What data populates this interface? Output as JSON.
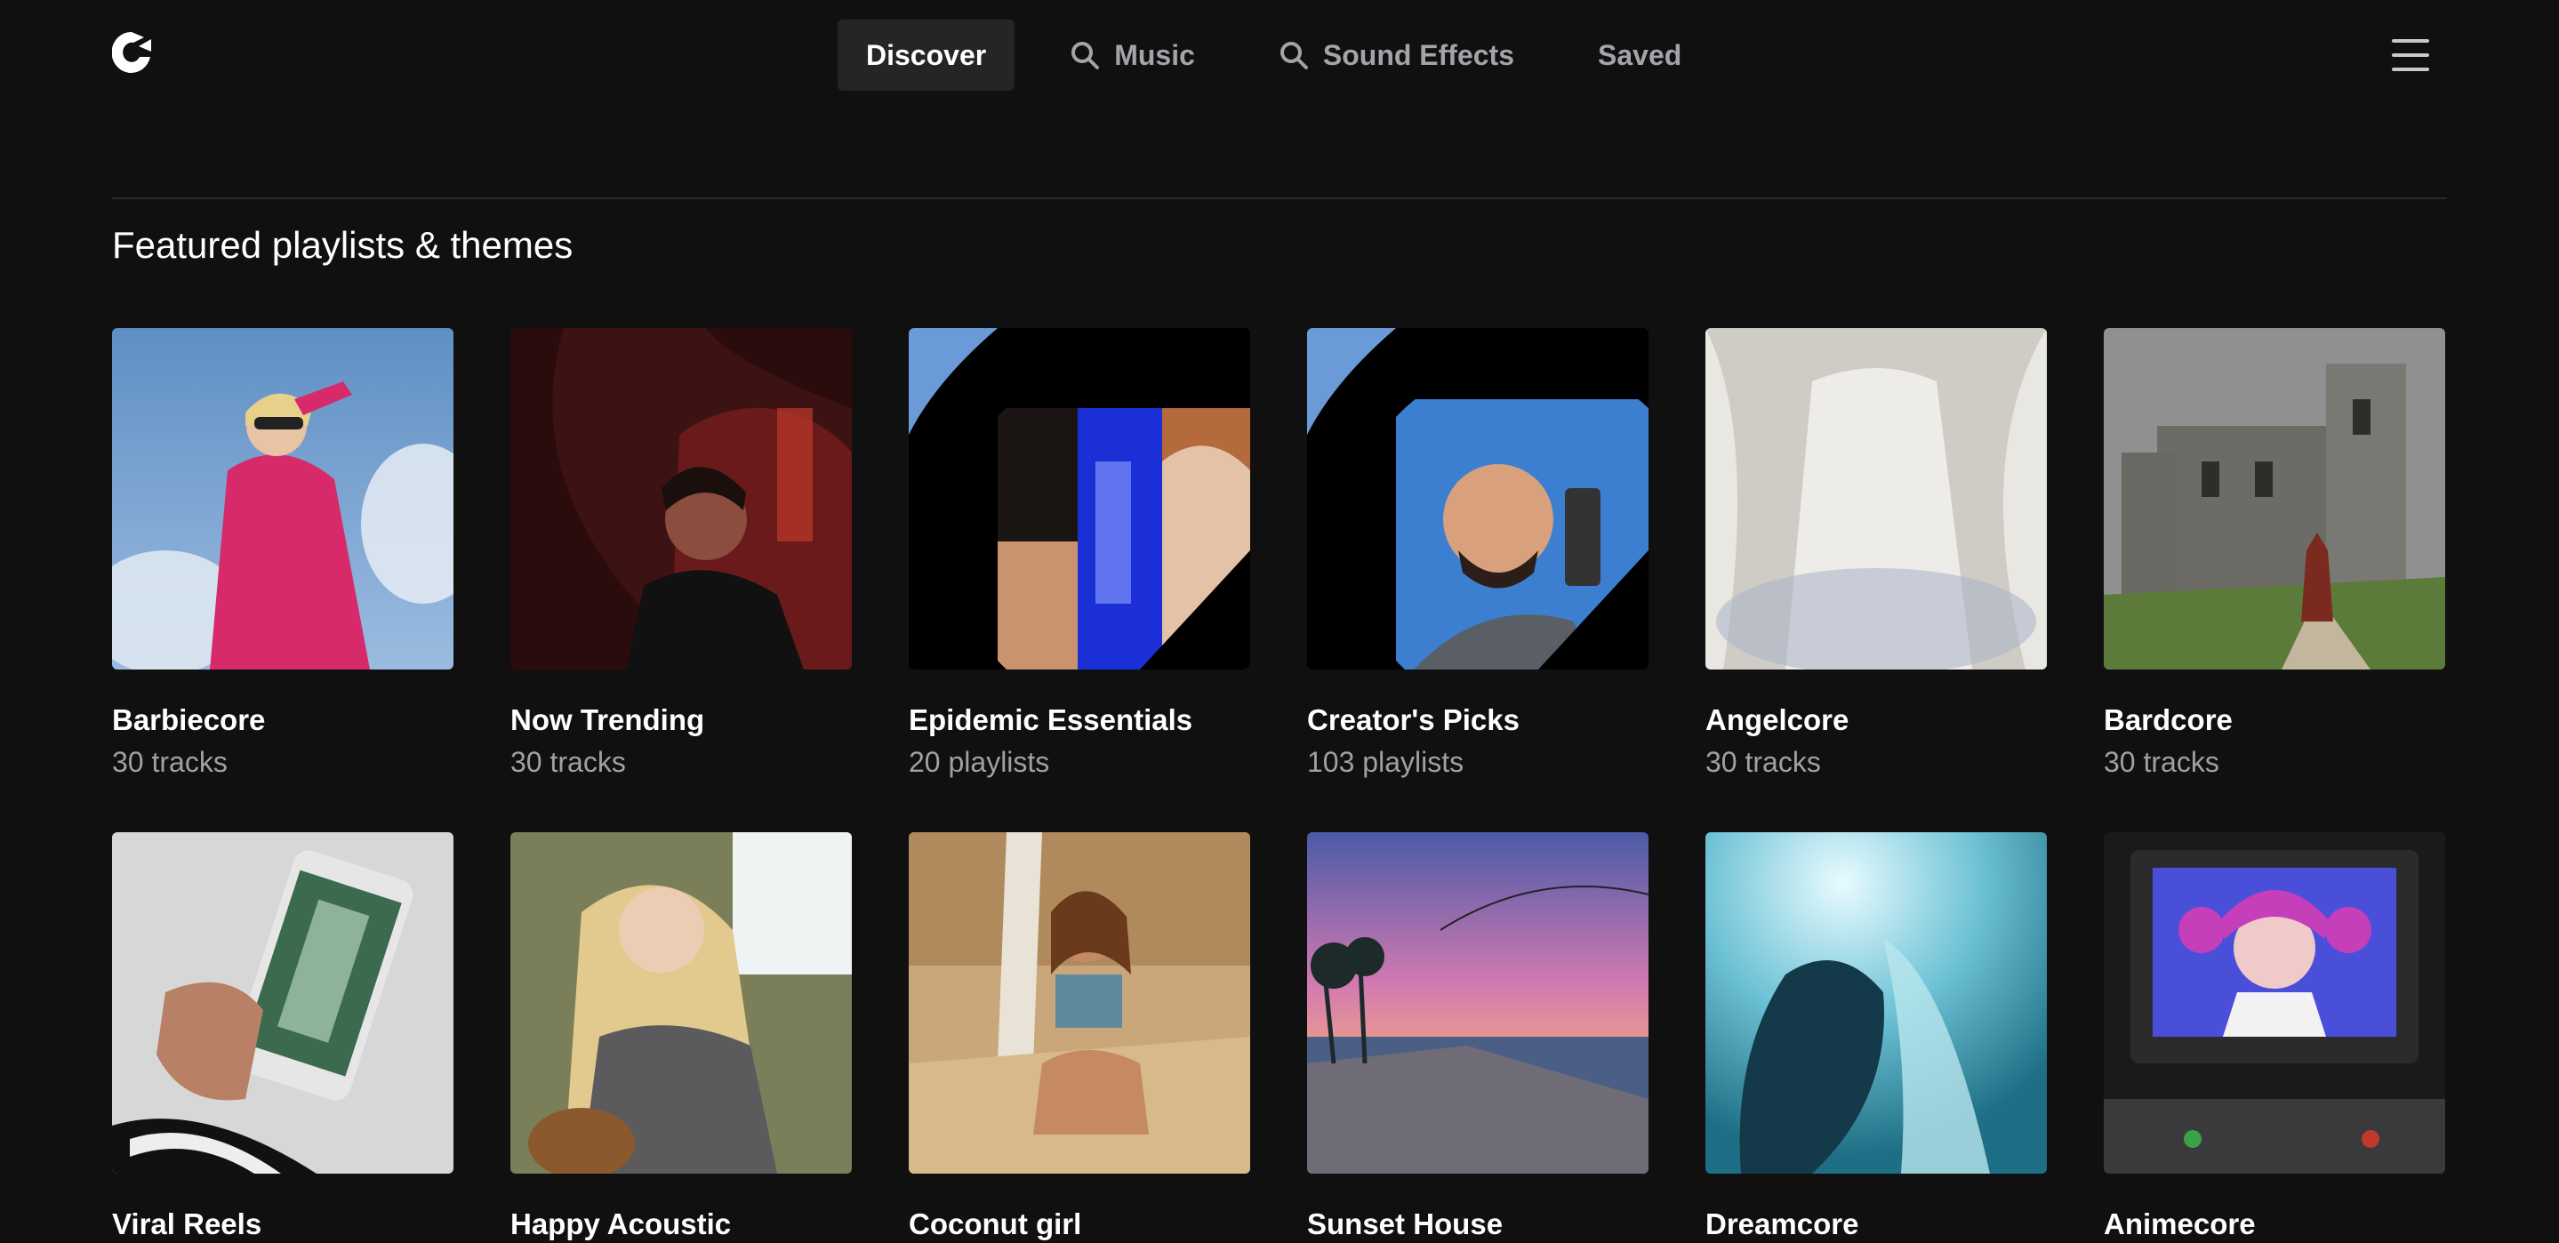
{
  "nav": {
    "items": [
      {
        "label": "Discover",
        "active": true,
        "icon": null
      },
      {
        "label": "Music",
        "active": false,
        "icon": "search-icon"
      },
      {
        "label": "Sound Effects",
        "active": false,
        "icon": "search-icon"
      },
      {
        "label": "Saved",
        "active": false,
        "icon": null
      }
    ]
  },
  "section": {
    "title": "Featured playlists & themes"
  },
  "cards": [
    {
      "title": "Barbiecore",
      "subtitle": "30 tracks"
    },
    {
      "title": "Now Trending",
      "subtitle": "30 tracks"
    },
    {
      "title": "Epidemic Essentials",
      "subtitle": "20 playlists"
    },
    {
      "title": "Creator's Picks",
      "subtitle": "103 playlists"
    },
    {
      "title": "Angelcore",
      "subtitle": "30 tracks"
    },
    {
      "title": "Bardcore",
      "subtitle": "30 tracks"
    },
    {
      "title": "Viral Reels",
      "subtitle": ""
    },
    {
      "title": "Happy Acoustic",
      "subtitle": ""
    },
    {
      "title": "Coconut girl",
      "subtitle": ""
    },
    {
      "title": "Sunset House",
      "subtitle": ""
    },
    {
      "title": "Dreamcore",
      "subtitle": ""
    },
    {
      "title": "Animecore",
      "subtitle": ""
    }
  ],
  "colors": {
    "background": "#101011",
    "nav_active_bg": "#252527",
    "muted_text": "#a0a0a5"
  }
}
